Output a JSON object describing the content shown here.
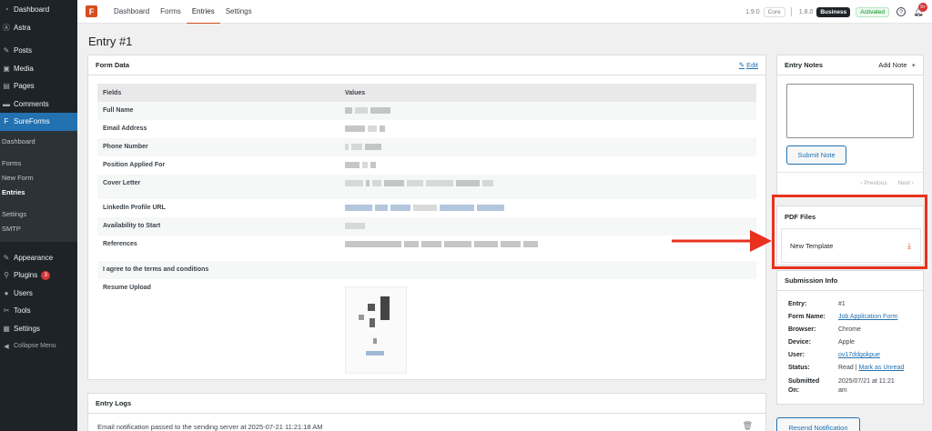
{
  "sidebar": {
    "items_top": [
      {
        "label": "Dashboard",
        "icon": "dashboard-icon"
      },
      {
        "label": "Astra",
        "icon": "astra-icon"
      }
    ],
    "items_mid": [
      {
        "label": "Posts",
        "icon": "pin-icon"
      },
      {
        "label": "Media",
        "icon": "media-icon"
      },
      {
        "label": "Pages",
        "icon": "pages-icon"
      },
      {
        "label": "Comments",
        "icon": "comments-icon"
      }
    ],
    "active": {
      "label": "SureForms",
      "icon": "sureforms-icon"
    },
    "submenu": [
      "Dashboard",
      "Forms",
      "New Form",
      "Entries",
      "Settings",
      "SMTP"
    ],
    "items_bottom": [
      {
        "label": "Appearance",
        "icon": "appearance-icon"
      },
      {
        "label": "Plugins",
        "icon": "plugins-icon",
        "badge": "3"
      },
      {
        "label": "Users",
        "icon": "users-icon"
      },
      {
        "label": "Tools",
        "icon": "tools-icon"
      },
      {
        "label": "Settings",
        "icon": "settings-icon"
      },
      {
        "label": "Collapse Menu",
        "icon": "collapse-icon"
      }
    ]
  },
  "topbar": {
    "logo": "F",
    "tabs": [
      "Dashboard",
      "Forms",
      "Entries",
      "Settings"
    ],
    "active_tab": "Entries",
    "core_version": "1.9.0",
    "core_label": "Core",
    "biz_version": "1.8.0",
    "biz_label": "Business",
    "status": "Activated",
    "notif_count": "9+"
  },
  "page_title": "Entry #1",
  "form_data": {
    "title": "Form Data",
    "edit_label": "Edit",
    "col_fields": "Fields",
    "col_values": "Values",
    "rows": [
      "Full Name",
      "Email Address",
      "Phone Number",
      "Position Applied For",
      "Cover Letter",
      "LinkedIn Profile URL",
      "Availability to Start",
      "References",
      "I agree to the terms and conditions",
      "Resume Upload"
    ]
  },
  "entry_logs": {
    "title": "Entry Logs",
    "line": "Email notification passed to the sending server at 2025-07-21 11:21:18 AM"
  },
  "entry_notes": {
    "title": "Entry Notes",
    "add_label": "Add Note",
    "submit_label": "Submit Note",
    "prev_label": "‹ Previous",
    "next_label": "Next ›"
  },
  "pdf_files": {
    "title": "PDF Files",
    "template": "New Template"
  },
  "submission_info": {
    "title": "Submission Info",
    "entry_k": "Entry:",
    "entry_v": "#1",
    "form_k": "Form Name:",
    "form_v": "Job Application Form",
    "browser_k": "Browser:",
    "browser_v": "Chrome",
    "device_k": "Device:",
    "device_v": "Apple",
    "user_k": "User:",
    "user_v": "ov17ddgokpue",
    "status_k": "Status:",
    "status_v": "Read |",
    "status_link": "Mark as Unread",
    "submitted_k1": "Submitted",
    "submitted_k2": "On:",
    "submitted_v1": "2025/07/21 at 11:21",
    "submitted_v2": "am",
    "resend_label": "Resend Notification"
  },
  "colors": {
    "accent": "#2271b1",
    "brand": "#d54e21",
    "highlight": "#e8321f",
    "sidebar": "#1d2327"
  }
}
